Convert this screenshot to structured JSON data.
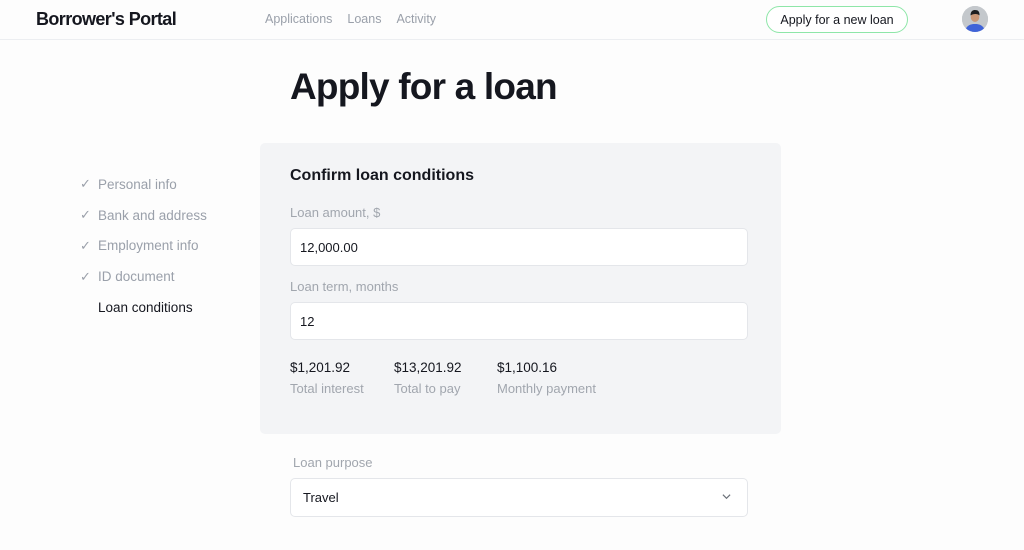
{
  "header": {
    "logo": "Borrower's Portal",
    "nav": [
      "Applications",
      "Loans",
      "Activity"
    ],
    "cta_label": "Apply for a new loan",
    "avatar_icon": "user-avatar"
  },
  "page": {
    "title": "Apply for a loan"
  },
  "steps": [
    {
      "label": "Personal info",
      "done": true
    },
    {
      "label": "Bank and address",
      "done": true
    },
    {
      "label": "Employment info",
      "done": true
    },
    {
      "label": "ID document",
      "done": true
    },
    {
      "label": "Loan conditions",
      "done": false
    }
  ],
  "step_icon": "✓",
  "card": {
    "title": "Confirm loan conditions",
    "amount_label": "Loan amount, $",
    "amount_value": "12,000.00",
    "term_label": "Loan term, months",
    "term_value": "12",
    "stats": [
      {
        "value": "$1,201.92",
        "label": "Total interest"
      },
      {
        "value": "$13,201.92",
        "label": "Total to pay"
      },
      {
        "value": "$1,100.16",
        "label": "Monthly payment"
      }
    ]
  },
  "purpose": {
    "label": "Loan purpose",
    "selected": "Travel"
  },
  "colors": {
    "accent_border": "#8ee6a8",
    "card_bg": "#f3f4f6",
    "muted_text": "#9aa0aa"
  }
}
